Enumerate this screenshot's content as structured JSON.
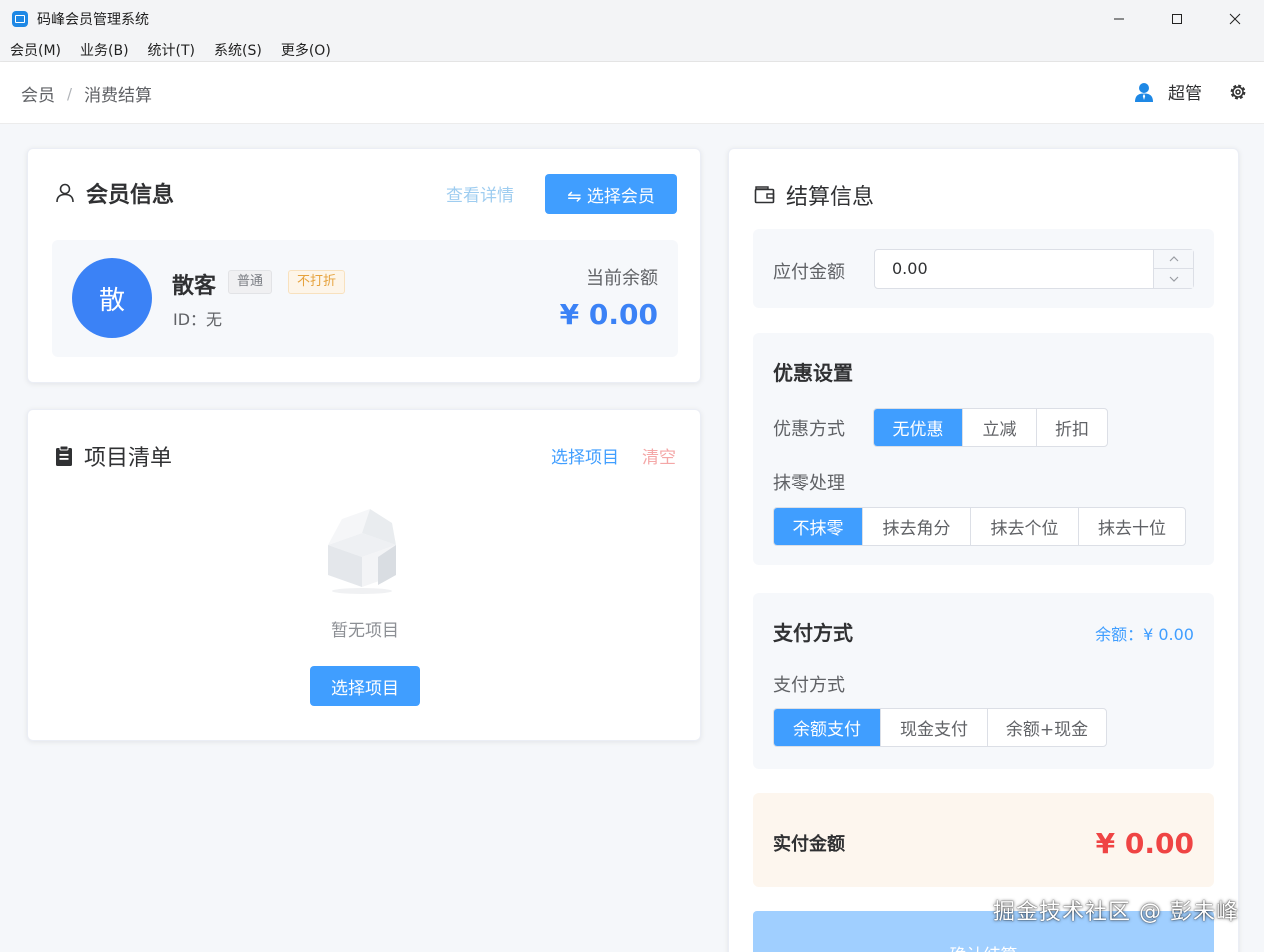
{
  "window": {
    "title": "码峰会员管理系统",
    "controls": {
      "minimize": "–",
      "maximize": "☐",
      "close": "✕"
    }
  },
  "menu": {
    "items": [
      "会员(M)",
      "业务(B)",
      "统计(T)",
      "系统(S)",
      "更多(O)"
    ]
  },
  "header": {
    "breadcrumb": [
      "会员",
      "消费结算"
    ],
    "separator": "/",
    "user_name": "超管",
    "icons": {
      "user": "user-avatar-icon",
      "settings": "gear-icon"
    }
  },
  "member": {
    "title": "会员信息",
    "view_details": "查看详情",
    "select_member": "⇋ 选择会员",
    "avatar_text": "散",
    "name": "散客",
    "level_tag": "普通",
    "discount_tag": "不打折",
    "id_text": "ID：无",
    "balance_label": "当前余额",
    "balance_value": "¥ 0.00"
  },
  "project": {
    "title": "项目清单",
    "select_project_link": "选择项目",
    "clear_link": "清空",
    "empty_text": "暂无项目",
    "select_project_button": "选择项目"
  },
  "settlement": {
    "title": "结算信息",
    "amount_label": "应付金额",
    "amount_value": "0.00",
    "discount": {
      "title": "优惠设置",
      "method_label": "优惠方式",
      "methods": [
        "无优惠",
        "立减",
        "折扣"
      ],
      "rounding_label": "抹零处理",
      "rounding_options": [
        "不抹零",
        "抹去角分",
        "抹去个位",
        "抹去十位"
      ]
    },
    "payment": {
      "title": "支付方式",
      "balance_text": "余额：¥ 0.00",
      "method_label": "支付方式",
      "methods": [
        "余额支付",
        "现金支付",
        "余额+现金"
      ]
    },
    "actual_label": "实付金额",
    "actual_value": "¥ 0.00",
    "confirm_button": "确认结算"
  },
  "watermark": "掘金技术社区 @ 彭未峰",
  "colors": {
    "primary": "#409eff",
    "accent_blue": "#3b82f6",
    "danger": "#ef4444",
    "background": "#f5f7fa"
  }
}
